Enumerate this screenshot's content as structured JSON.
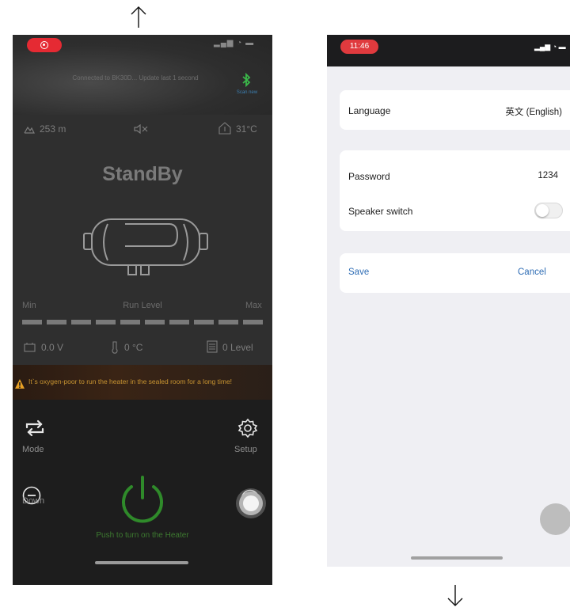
{
  "left_app": {
    "connection_text": "Connected to BK30D...  Update last 1 second",
    "bt_label": "Scan new",
    "altitude": "253 m",
    "outside_temp": "31°C",
    "status": "StandBy",
    "level": {
      "min_label": "Min",
      "run_label": "Run Level",
      "max_label": "Max",
      "total_segments": 10,
      "filled_segments": 0
    },
    "readings": {
      "voltage": "0.0 V",
      "heater_temp": "0 °C",
      "level": "0 Level"
    },
    "warning": "It`s oxygen-poor to run the heater in the sealed room for a long time!",
    "controls": {
      "mode_label": "Mode",
      "setup_label": "Setup",
      "down_label": "Down",
      "push_text": "Push to turn on the Heater"
    }
  },
  "right_app": {
    "status_time": "11:46",
    "settings": {
      "language_label": "Language",
      "language_value": "英文 (English)",
      "password_label": "Password",
      "password_value": "1234",
      "speaker_label": "Speaker switch",
      "speaker_on": false,
      "save_label": "Save",
      "cancel_label": "Cancel"
    }
  },
  "colors": {
    "accent_green": "#2f8a2a",
    "warning_orange": "#c89431",
    "link_blue": "#2f6db5",
    "record_red": "#e52a33",
    "bt_green": "#3bb94a"
  },
  "icons": {
    "scroll_up": "arrow-up-icon",
    "scroll_down": "arrow-down-icon",
    "bluetooth": "bluetooth-icon",
    "mode": "swap-arrows-icon",
    "setup": "gear-icon",
    "down": "minus-circle-icon",
    "up": "plus-circle-icon",
    "power": "power-icon",
    "warning": "warning-triangle-icon"
  }
}
